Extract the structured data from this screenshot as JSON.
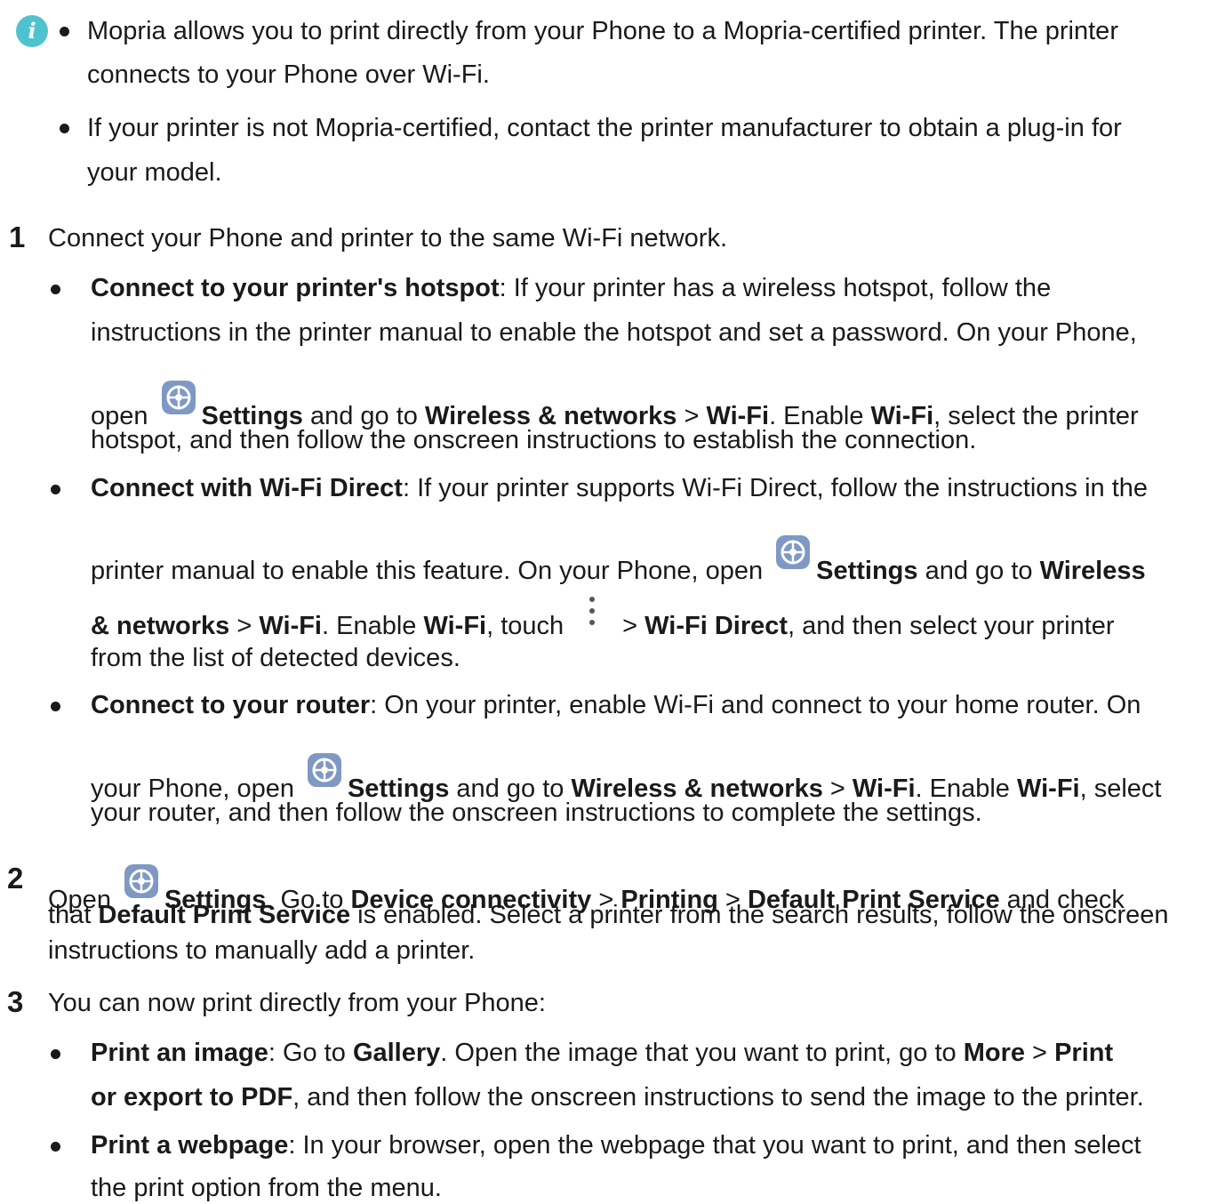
{
  "icons": {
    "info": "info-icon",
    "settings": "settings-gear-icon",
    "more": "more-vertical-icon"
  },
  "colors": {
    "info_icon": "#4fc2cf",
    "settings_icon": "#7f98c4",
    "text": "#1a1a1a"
  },
  "info_symbol": "i",
  "note": {
    "b1_l1": "Mopria allows you to print directly from your Phone to a Mopria-certified printer. The printer",
    "b1_l2": "connects to your Phone over Wi-Fi.",
    "b2_l1": "If your printer is not Mopria-certified, contact the printer manufacturer to obtain a plug-in for",
    "b2_l2": "your model."
  },
  "step1": {
    "num": "1",
    "text": "Connect your Phone and printer to the same Wi-Fi network.",
    "hotspot": {
      "title": "Connect to your printer's hotspot",
      "l1_rest": ": If your printer has a wireless hotspot, follow the",
      "l2": "instructions in the printer manual to enable the hotspot and set a password. On your Phone,",
      "l3_open": "open",
      "settings": "Settings",
      "l3_goto": " and go to ",
      "wireless": "Wireless & networks",
      "sep": " > ",
      "wifi": "Wi-Fi",
      "l3_enable": ". Enable ",
      "wifi2": "Wi-Fi",
      "l3_end": ", select the printer",
      "l4": "hotspot, and then follow the onscreen instructions to establish the connection."
    },
    "direct": {
      "title": "Connect with Wi-Fi Direct",
      "l1_rest": ": If your printer supports Wi-Fi Direct, follow the instructions in the",
      "l2_start": "printer manual to enable this feature. On your Phone, open",
      "settings": "Settings",
      "l2_goto": " and go to ",
      "wireless_a": "Wireless",
      "wireless_b": "& networks",
      "sep": " > ",
      "wifi": "Wi-Fi",
      "l3_enable": ". Enable ",
      "wifi2": "Wi-Fi",
      "l3_touch": ", touch",
      "sep2": "> ",
      "wifi_direct": "Wi-Fi Direct",
      "l3_end": ", and then select your printer",
      "l4": "from the list of detected devices."
    },
    "router": {
      "title": "Connect to your router",
      "l1_rest": ": On your printer, enable Wi-Fi and connect to your home router. On",
      "l2_start": "your Phone, open",
      "settings": "Settings",
      "l2_goto": " and go to ",
      "wireless": "Wireless & networks",
      "sep": " > ",
      "wifi": "Wi-Fi",
      "l2_enable": ". Enable ",
      "wifi2": "Wi-Fi",
      "l2_end": ", select",
      "l3": "your router, and then follow the onscreen instructions to complete the settings."
    }
  },
  "step2": {
    "num": "2",
    "open": "Open",
    "settings": "Settings",
    "goto": ". Go to ",
    "device": "Device connectivity",
    "sep": " > ",
    "printing": "Printing",
    "sep2": " > ",
    "default_service": "Default Print Service",
    "check": " and check",
    "l2_that": "that ",
    "default_service2": "Default Print Service",
    "l2_rest": " is enabled. Select a printer from the search results, follow the onscreen",
    "l3": "instructions to manually add a printer."
  },
  "step3": {
    "num": "3",
    "text": "You can now print directly from your Phone:",
    "image": {
      "title": "Print an image",
      "goto": ": Go to ",
      "gallery": "Gallery",
      "open": ". Open the image that you want to print, go to ",
      "more": "More",
      "sep": " > ",
      "print": "Print",
      "l2_bold": "or export to PDF",
      "l2_rest": ", and then follow the onscreen instructions to send the image to the printer."
    },
    "webpage": {
      "title": "Print a webpage",
      "l1_rest": ": In your browser, open the webpage that you want to print, and then select",
      "l2": "the print option from the menu."
    }
  }
}
